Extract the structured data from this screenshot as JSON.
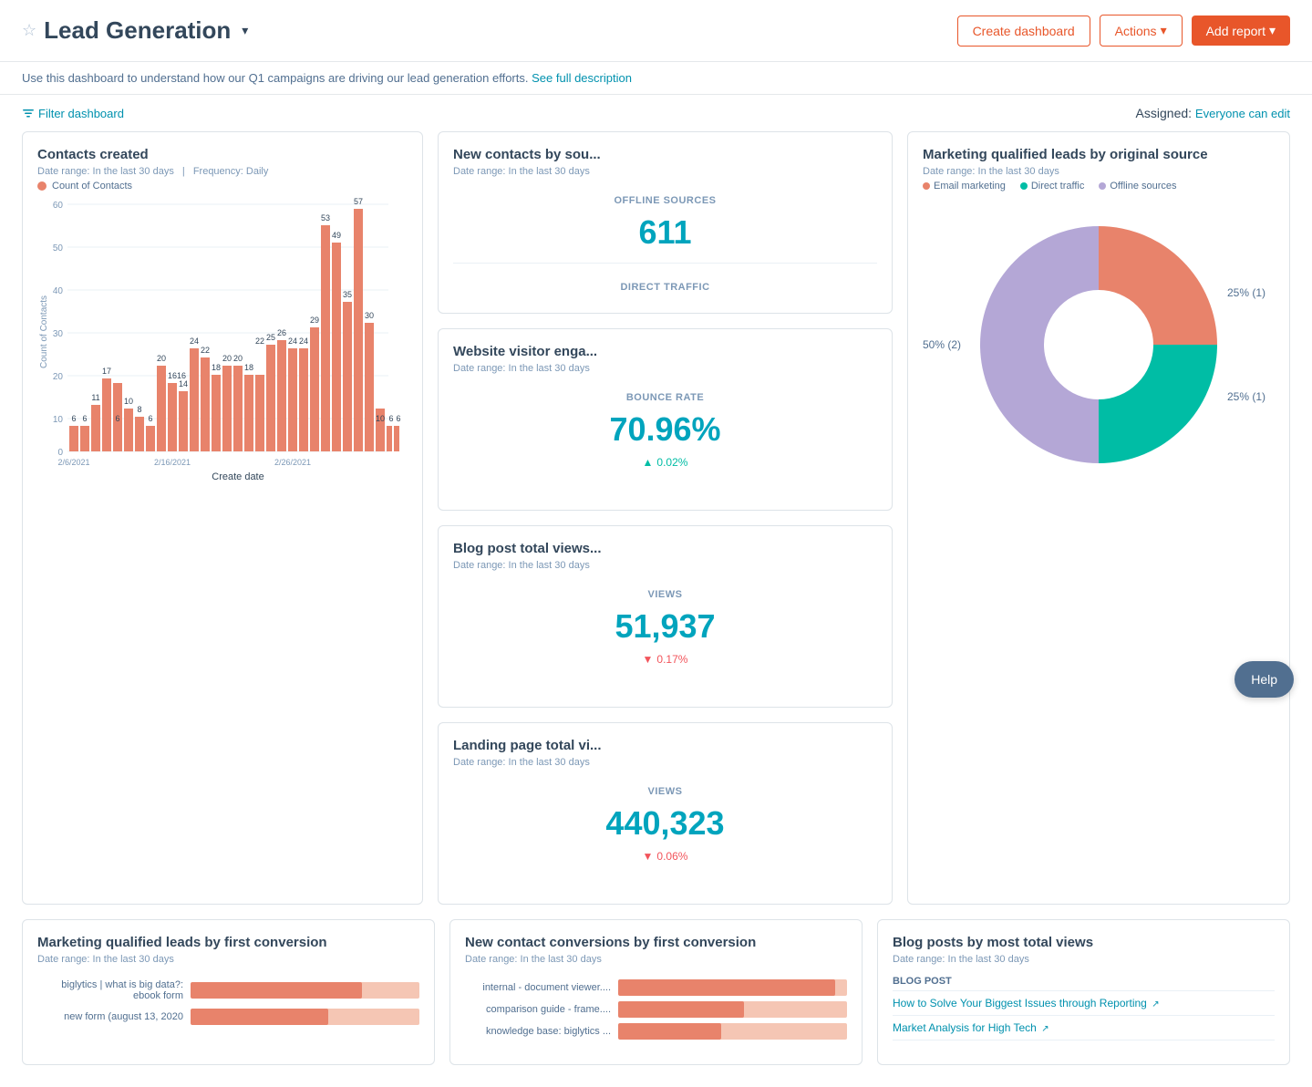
{
  "header": {
    "star_icon": "☆",
    "title": "Lead Generation",
    "chevron": "▾",
    "create_dashboard_label": "Create dashboard",
    "actions_label": "Actions",
    "actions_chevron": "▾",
    "add_report_label": "Add report",
    "add_report_chevron": "▾"
  },
  "description": {
    "text": "Use this dashboard to understand how our Q1 campaigns are driving our lead generation efforts.",
    "link_text": "See full description"
  },
  "filter_bar": {
    "filter_label": "Filter dashboard",
    "assigned_label": "Assigned:",
    "assigned_value": "Everyone can edit"
  },
  "contacts_created": {
    "title": "Contacts created",
    "date_range": "Date range: In the last 30 days",
    "frequency": "Frequency: Daily",
    "legend_label": "Count of Contacts",
    "x_label": "Create date",
    "y_label": "Count of Contacts",
    "bars": [
      {
        "label": "2/6/2021",
        "value": 6
      },
      {
        "label": "",
        "value": 6
      },
      {
        "label": "",
        "value": 11
      },
      {
        "label": "",
        "value": 17
      },
      {
        "label": "",
        "value": 16
      },
      {
        "label": "",
        "value": 10
      },
      {
        "label": "",
        "value": 8
      },
      {
        "label": "",
        "value": 6
      },
      {
        "label": "",
        "value": 20
      },
      {
        "label": "2/16/2021",
        "value": 16
      },
      {
        "label": "",
        "value": 14
      },
      {
        "label": "",
        "value": 24
      },
      {
        "label": "",
        "value": 22
      },
      {
        "label": "",
        "value": 18
      },
      {
        "label": "",
        "value": 20
      },
      {
        "label": "",
        "value": 20
      },
      {
        "label": "",
        "value": 18
      },
      {
        "label": "",
        "value": 18
      },
      {
        "label": "",
        "value": 25
      },
      {
        "label": "",
        "value": 26
      },
      {
        "label": "2/26/2021",
        "value": 24
      },
      {
        "label": "",
        "value": 24
      },
      {
        "label": "",
        "value": 29
      },
      {
        "label": "",
        "value": 53
      },
      {
        "label": "",
        "value": 49
      },
      {
        "label": "",
        "value": 35
      },
      {
        "label": "",
        "value": 57
      },
      {
        "label": "",
        "value": 30
      },
      {
        "label": "",
        "value": 10
      },
      {
        "label": "",
        "value": 6
      },
      {
        "label": "",
        "value": 6
      }
    ]
  },
  "new_contacts_by_source": {
    "title": "New contacts by sou...",
    "date_range": "Date range: In the last 30 days",
    "offline_label": "OFFLINE SOURCES",
    "offline_value": "611",
    "direct_label": "DIRECT TRAFFIC",
    "direct_value": ""
  },
  "website_visitor": {
    "title": "Website visitor enga...",
    "date_range": "Date range: In the last 30 days",
    "bounce_label": "BOUNCE RATE",
    "bounce_value": "70.96%",
    "bounce_change": "0.02%",
    "bounce_direction": "up"
  },
  "mql_by_source": {
    "title": "Marketing qualified leads by original source",
    "date_range": "Date range: In the last 30 days",
    "legend": [
      {
        "label": "Email marketing",
        "color": "#e8836b"
      },
      {
        "label": "Direct traffic",
        "color": "#00bda5"
      },
      {
        "label": "Offline sources",
        "color": "#b4a7d6"
      }
    ],
    "slices": [
      {
        "label": "50% (2)",
        "color": "#b4a7d6",
        "pct": 50,
        "side": "left"
      },
      {
        "label": "25% (1)",
        "color": "#e8836b",
        "pct": 25,
        "side": "right-top"
      },
      {
        "label": "25% (1)",
        "color": "#00bda5",
        "pct": 25,
        "side": "right-bottom"
      }
    ]
  },
  "blog_post_views": {
    "title": "Blog post total views...",
    "date_range": "Date range: In the last 30 days",
    "views_label": "VIEWS",
    "views_value": "51,937",
    "change": "0.17%",
    "direction": "down"
  },
  "landing_page_views": {
    "title": "Landing page total vi...",
    "date_range": "Date range: In the last 30 days",
    "views_label": "VIEWS",
    "views_value": "440,323",
    "change": "0.06%",
    "direction": "down"
  },
  "mql_first_conversion": {
    "title": "Marketing qualified leads by first conversion",
    "date_range": "Date range: In the last 30 days",
    "bars": [
      {
        "label": "biglytics | what is big data?:\nebook form",
        "pct": 75
      },
      {
        "label": "new form (august 13, 2020",
        "pct": 60
      }
    ]
  },
  "new_contact_conversions": {
    "title": "New contact conversions by first conversion",
    "date_range": "Date range: In the last 30 days",
    "bars": [
      {
        "label": "internal - document viewer....",
        "pct": 95
      },
      {
        "label": "comparison guide - frame....",
        "pct": 55
      },
      {
        "label": "knowledge base: biglytics ...",
        "pct": 45
      }
    ]
  },
  "blog_posts_views": {
    "title": "Blog posts by most total views",
    "date_range": "Date range: In the last 30 days",
    "col_header": "BLOG POST",
    "rows": [
      {
        "title": "How to Solve Your Biggest Issues through Reporting",
        "has_link": true
      },
      {
        "title": "Market Analysis for High Tech",
        "has_link": true
      }
    ]
  },
  "help": {
    "label": "Help"
  }
}
